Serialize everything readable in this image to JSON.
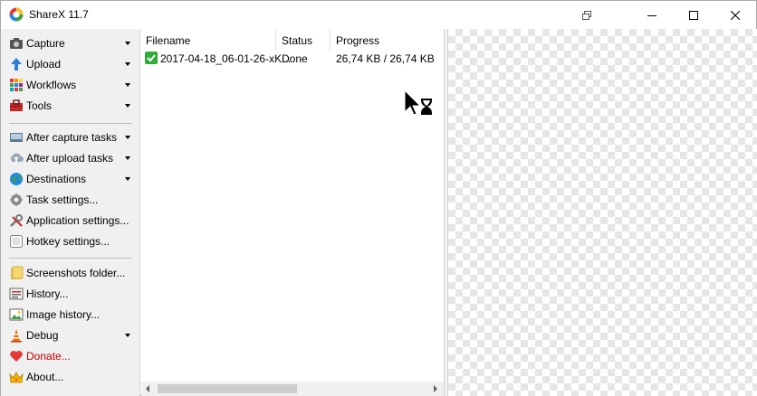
{
  "window": {
    "title": "ShareX 11.7"
  },
  "sidebar": {
    "items": [
      {
        "label": "Capture",
        "icon": "capture-icon",
        "has_submenu": true
      },
      {
        "label": "Upload",
        "icon": "upload-icon",
        "has_submenu": true
      },
      {
        "label": "Workflows",
        "icon": "workflows-icon",
        "has_submenu": true
      },
      {
        "label": "Tools",
        "icon": "tools-icon",
        "has_submenu": true
      },
      {
        "label": "After capture tasks",
        "icon": "after-capture-icon",
        "has_submenu": true
      },
      {
        "label": "After upload tasks",
        "icon": "after-upload-icon",
        "has_submenu": true
      },
      {
        "label": "Destinations",
        "icon": "destinations-icon",
        "has_submenu": true
      },
      {
        "label": "Task settings...",
        "icon": "task-settings-icon",
        "has_submenu": false
      },
      {
        "label": "Application settings...",
        "icon": "app-settings-icon",
        "has_submenu": false
      },
      {
        "label": "Hotkey settings...",
        "icon": "hotkey-icon",
        "has_submenu": false
      },
      {
        "label": "Screenshots folder...",
        "icon": "folder-icon",
        "has_submenu": false
      },
      {
        "label": "History...",
        "icon": "history-icon",
        "has_submenu": false
      },
      {
        "label": "Image history...",
        "icon": "image-history-icon",
        "has_submenu": false
      },
      {
        "label": "Debug",
        "icon": "debug-icon",
        "has_submenu": true
      },
      {
        "label": "Donate...",
        "icon": "heart-icon",
        "has_submenu": false
      },
      {
        "label": "About...",
        "icon": "crown-icon",
        "has_submenu": false
      }
    ]
  },
  "list": {
    "columns": [
      "Filename",
      "Status",
      "Progress"
    ],
    "rows": [
      {
        "filename": "2017-04-18_06-01-26-xK...",
        "status": "Done",
        "progress": "26,74 KB / 26,74 KB"
      }
    ]
  },
  "colors": {
    "accent_red": "#c00000",
    "done_green": "#2fae37",
    "sidebar_bg": "#f0f0f0"
  }
}
